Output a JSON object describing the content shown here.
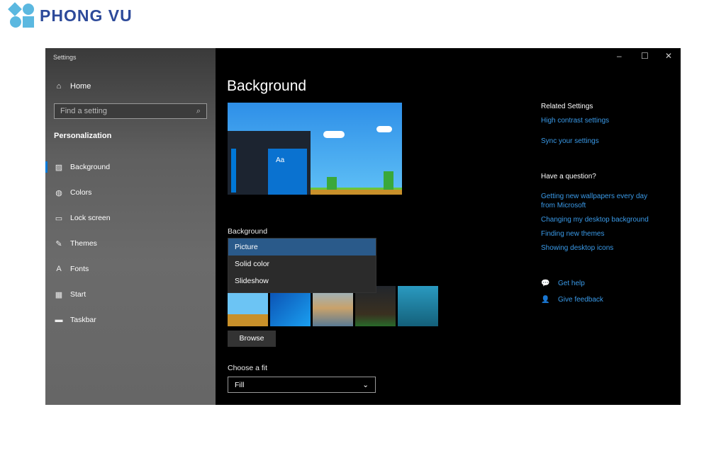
{
  "logo": {
    "text": "PHONG VU",
    "color": "#2d4a9a",
    "mark_color": "#5bb8e0"
  },
  "window": {
    "title": "Settings",
    "controls": [
      "minimize",
      "maximize",
      "close"
    ]
  },
  "sidebar": {
    "home": "Home",
    "search_placeholder": "Find a setting",
    "section": "Personalization",
    "items": [
      {
        "label": "Background",
        "icon": "image-icon",
        "selected": true
      },
      {
        "label": "Colors",
        "icon": "palette-icon"
      },
      {
        "label": "Lock screen",
        "icon": "lock-screen-icon"
      },
      {
        "label": "Themes",
        "icon": "themes-icon"
      },
      {
        "label": "Fonts",
        "icon": "fonts-icon"
      },
      {
        "label": "Start",
        "icon": "start-icon"
      },
      {
        "label": "Taskbar",
        "icon": "taskbar-icon"
      }
    ]
  },
  "main": {
    "title": "Background",
    "preview_tile": "Aa",
    "background_label": "Background",
    "dropdown_options": [
      "Picture",
      "Solid color",
      "Slideshow"
    ],
    "dropdown_selected": "Picture",
    "browse": "Browse",
    "fit_label": "Choose a fit",
    "fit_value": "Fill",
    "accent": "#0078d7"
  },
  "related": {
    "title": "Related Settings",
    "links": [
      "High contrast settings",
      "Sync your settings"
    ],
    "question_title": "Have a question?",
    "question_links": [
      "Getting new wallpapers every day from Microsoft",
      "Changing my desktop background",
      "Finding new themes",
      "Showing desktop icons"
    ],
    "help": "Get help",
    "feedback": "Give feedback",
    "link_color": "#3a9ae8"
  }
}
